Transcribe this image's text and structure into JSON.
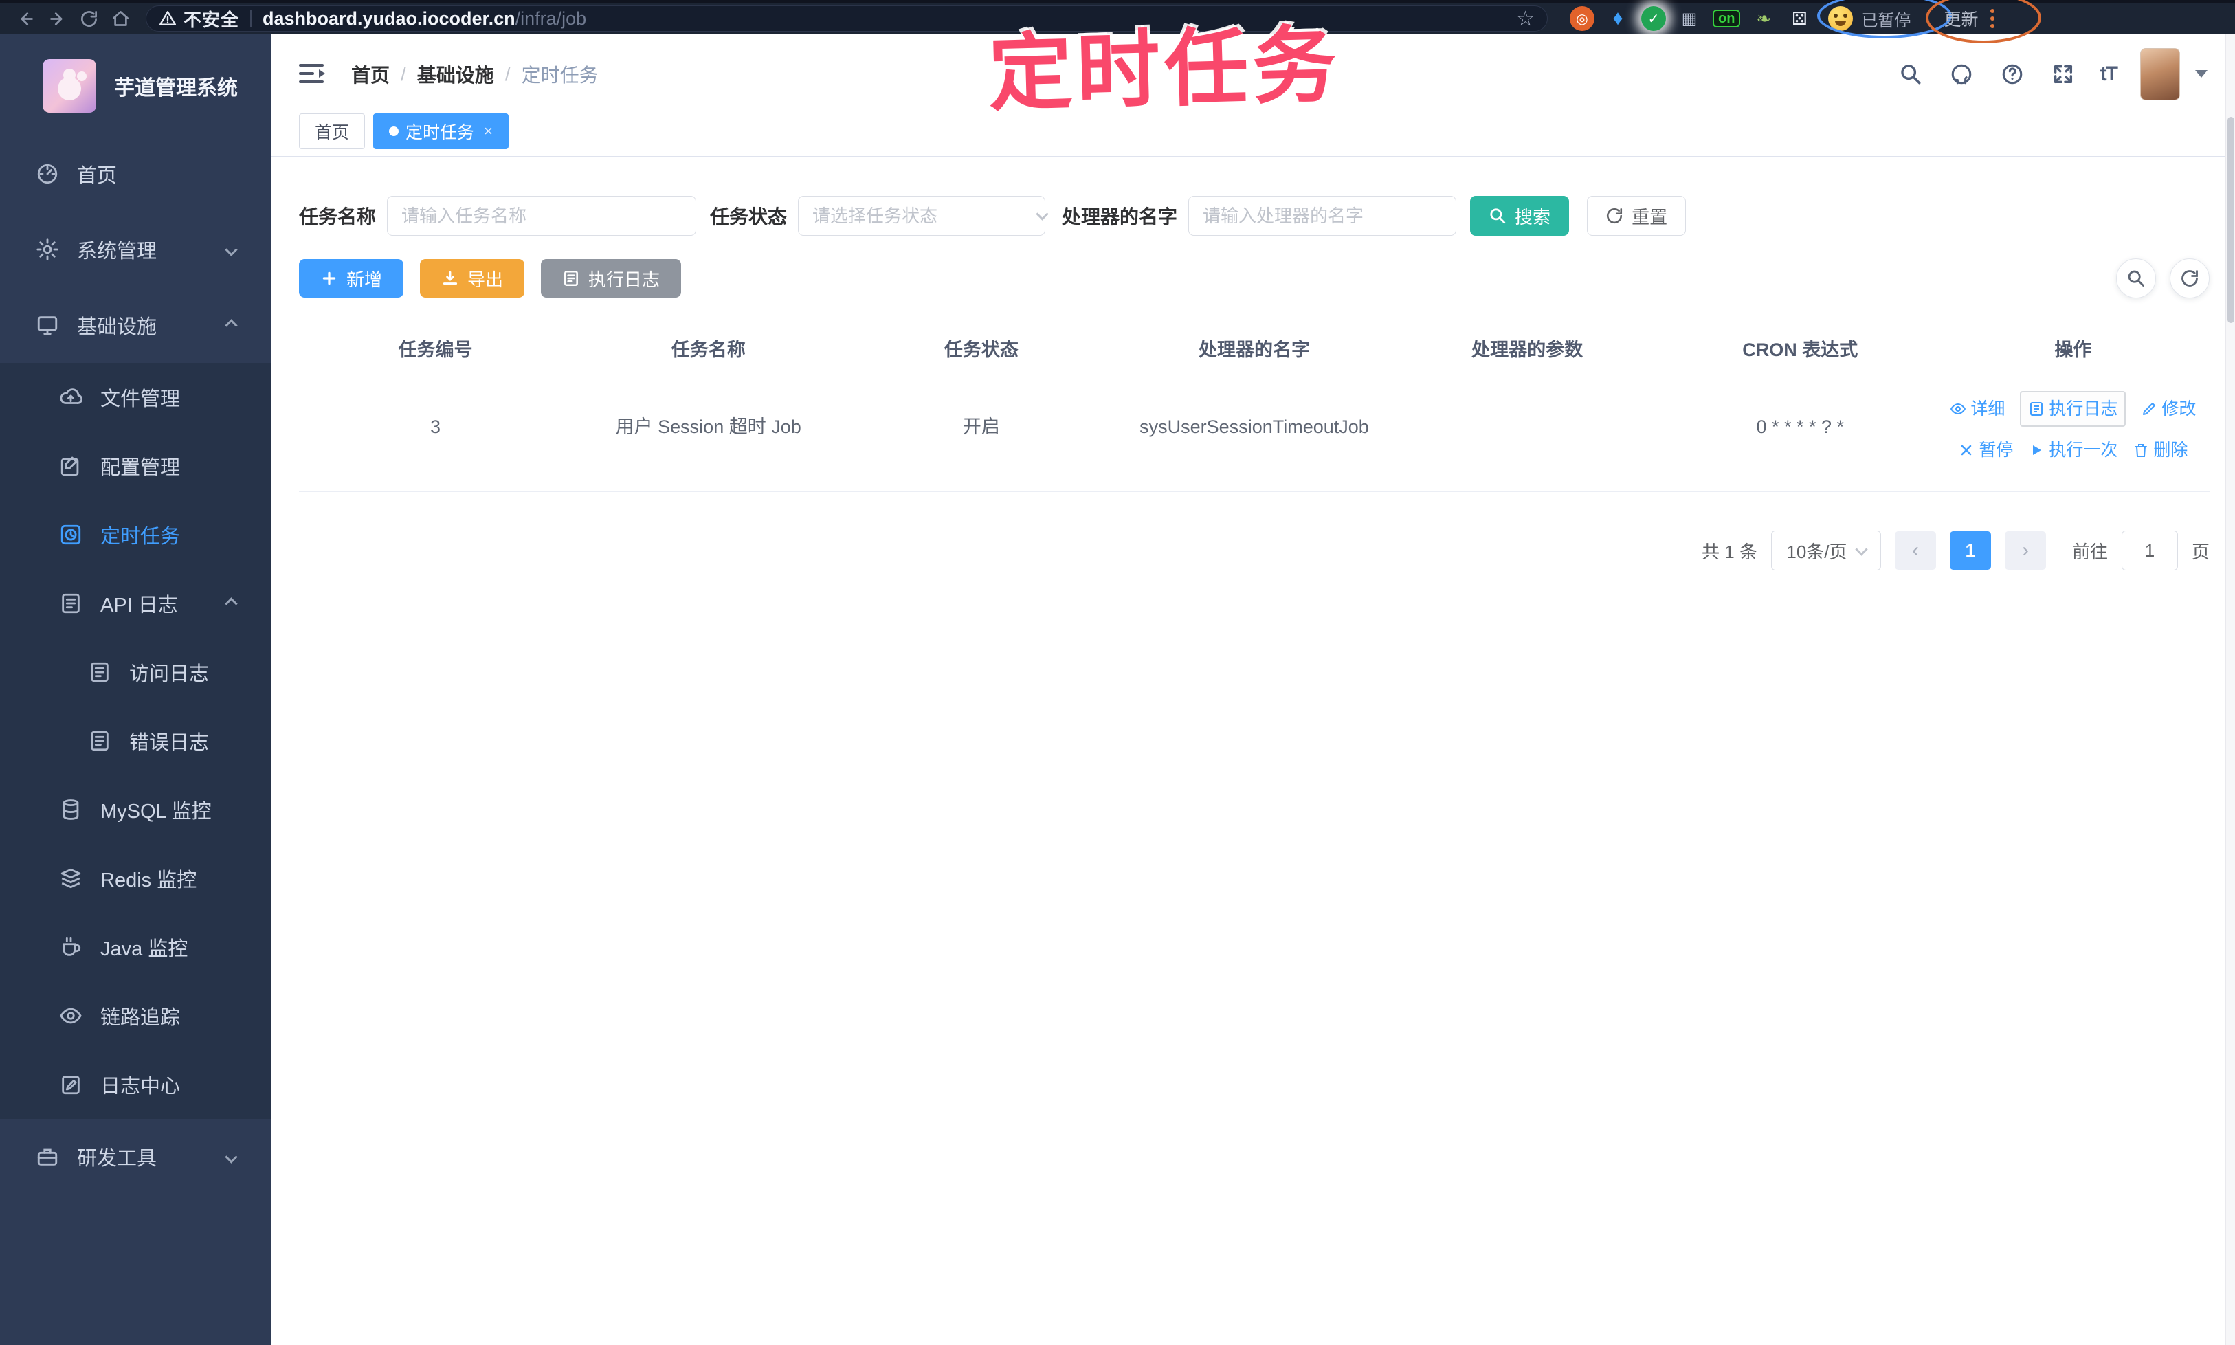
{
  "browser": {
    "security_label": "不安全",
    "url_host": "dashboard.yudao.iocoder.cn",
    "url_path": "/infra/job",
    "on_badge": "on",
    "profile_paused_label": "已暂停",
    "update_label": "更新"
  },
  "annotation": {
    "title": "定时任务"
  },
  "sidebar": {
    "app_title": "芋道管理系统",
    "items": [
      {
        "label": "首页",
        "level": 1
      },
      {
        "label": "系统管理",
        "level": 1,
        "chevron": "down"
      },
      {
        "label": "基础设施",
        "level": 1,
        "chevron": "up"
      },
      {
        "label": "文件管理",
        "level": 2
      },
      {
        "label": "配置管理",
        "level": 2
      },
      {
        "label": "定时任务",
        "level": 2,
        "active": true
      },
      {
        "label": "API 日志",
        "level": 2,
        "chevron": "up"
      },
      {
        "label": "访问日志",
        "level": 3
      },
      {
        "label": "错误日志",
        "level": 3
      },
      {
        "label": "MySQL 监控",
        "level": 2
      },
      {
        "label": "Redis 监控",
        "level": 2
      },
      {
        "label": "Java 监控",
        "level": 2
      },
      {
        "label": "链路追踪",
        "level": 2
      },
      {
        "label": "日志中心",
        "level": 2
      },
      {
        "label": "研发工具",
        "level": 1,
        "chevron": "down"
      }
    ]
  },
  "header": {
    "breadcrumb": [
      "首页",
      "基础设施",
      "定时任务"
    ],
    "separator": "/",
    "font_size_glyph": "tT"
  },
  "tabs": [
    {
      "label": "首页",
      "active": false
    },
    {
      "label": "定时任务",
      "active": true,
      "close": "×"
    }
  ],
  "filters": {
    "name_label": "任务名称",
    "name_placeholder": "请输入任务名称",
    "status_label": "任务状态",
    "status_placeholder": "请选择任务状态",
    "handler_label": "处理器的名字",
    "handler_placeholder": "请输入处理器的名字",
    "search_label": "搜索",
    "reset_label": "重置"
  },
  "toolbar": {
    "add_label": "新增",
    "export_label": "导出",
    "exec_log_label": "执行日志"
  },
  "table": {
    "columns": [
      "任务编号",
      "任务名称",
      "任务状态",
      "处理器的名字",
      "处理器的参数",
      "CRON 表达式",
      "操作"
    ],
    "rows": [
      {
        "id": "3",
        "name": "用户 Session 超时 Job",
        "status": "开启",
        "handler": "sysUserSessionTimeoutJob",
        "param": "",
        "cron": "0 * * * * ? *",
        "ops": {
          "detail": "详细",
          "exec_log": "执行日志",
          "edit": "修改",
          "pause": "暂停",
          "run_once": "执行一次",
          "delete": "删除"
        }
      }
    ]
  },
  "pagination": {
    "total": "共 1 条",
    "page_size": "10条/页",
    "current_page": "1",
    "goto_label": "前往",
    "goto_value": "1",
    "page_unit": "页"
  }
}
